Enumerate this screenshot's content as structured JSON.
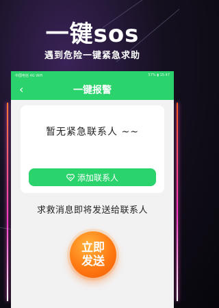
{
  "hero": {
    "title": "一键sos",
    "subtitle": "遇到危险一键紧急求助"
  },
  "status_bar": {
    "left": "中国电信  4G  WiFi",
    "right": "57%  ▮  15:47"
  },
  "app_bar": {
    "back_icon": "chevron-left-icon",
    "title": "一键报警"
  },
  "contacts_card": {
    "empty_text": "暂无紧急联系人 ~~",
    "add_button_icon": "heart-icon",
    "add_button_label": "添加联系人"
  },
  "notice_text": "求救消息即将发送给联系人",
  "sos_button": {
    "line1": "立即",
    "line2": "发送"
  },
  "colors": {
    "accent_green": "#2ad36b",
    "sos_orange": "#ff7a12",
    "background_dark": "#07060b",
    "neon_pink": "#ff3cc8"
  }
}
